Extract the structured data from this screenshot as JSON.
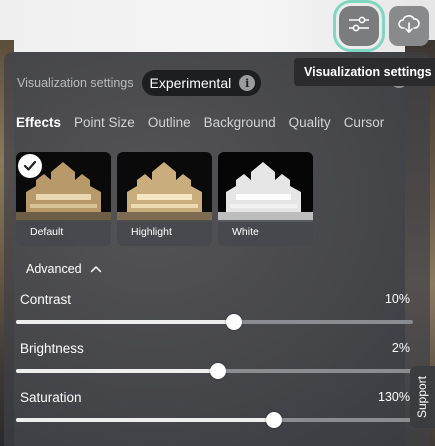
{
  "toolbar": {
    "settings_icon": "sliders-icon",
    "download_icon": "cloud-download-icon",
    "tooltip": "Visualization settings"
  },
  "panel": {
    "title": "Visualization settings",
    "chip_label": "Experimental",
    "info_icon": "info-icon",
    "info_glyph": "i"
  },
  "tabs": [
    {
      "label": "Effects",
      "active": true
    },
    {
      "label": "Point Size"
    },
    {
      "label": "Outline"
    },
    {
      "label": "Background"
    },
    {
      "label": "Quality"
    },
    {
      "label": "Cursor"
    }
  ],
  "effects": [
    {
      "label": "Default",
      "selected": true
    },
    {
      "label": "Highlight"
    },
    {
      "label": "White"
    }
  ],
  "advanced": {
    "label": "Advanced",
    "expanded": true
  },
  "sliders": [
    {
      "label": "Contrast",
      "value_text": "10%",
      "position": 0.55
    },
    {
      "label": "Brightness",
      "value_text": "2%",
      "position": 0.51
    },
    {
      "label": "Saturation",
      "value_text": "130%",
      "position": 0.65
    }
  ],
  "support": {
    "label": "Support"
  },
  "colors": {
    "accent_outline": "#7fd6c2",
    "panel_bg": "#3e4046",
    "chip_bg": "#1d1e21"
  }
}
